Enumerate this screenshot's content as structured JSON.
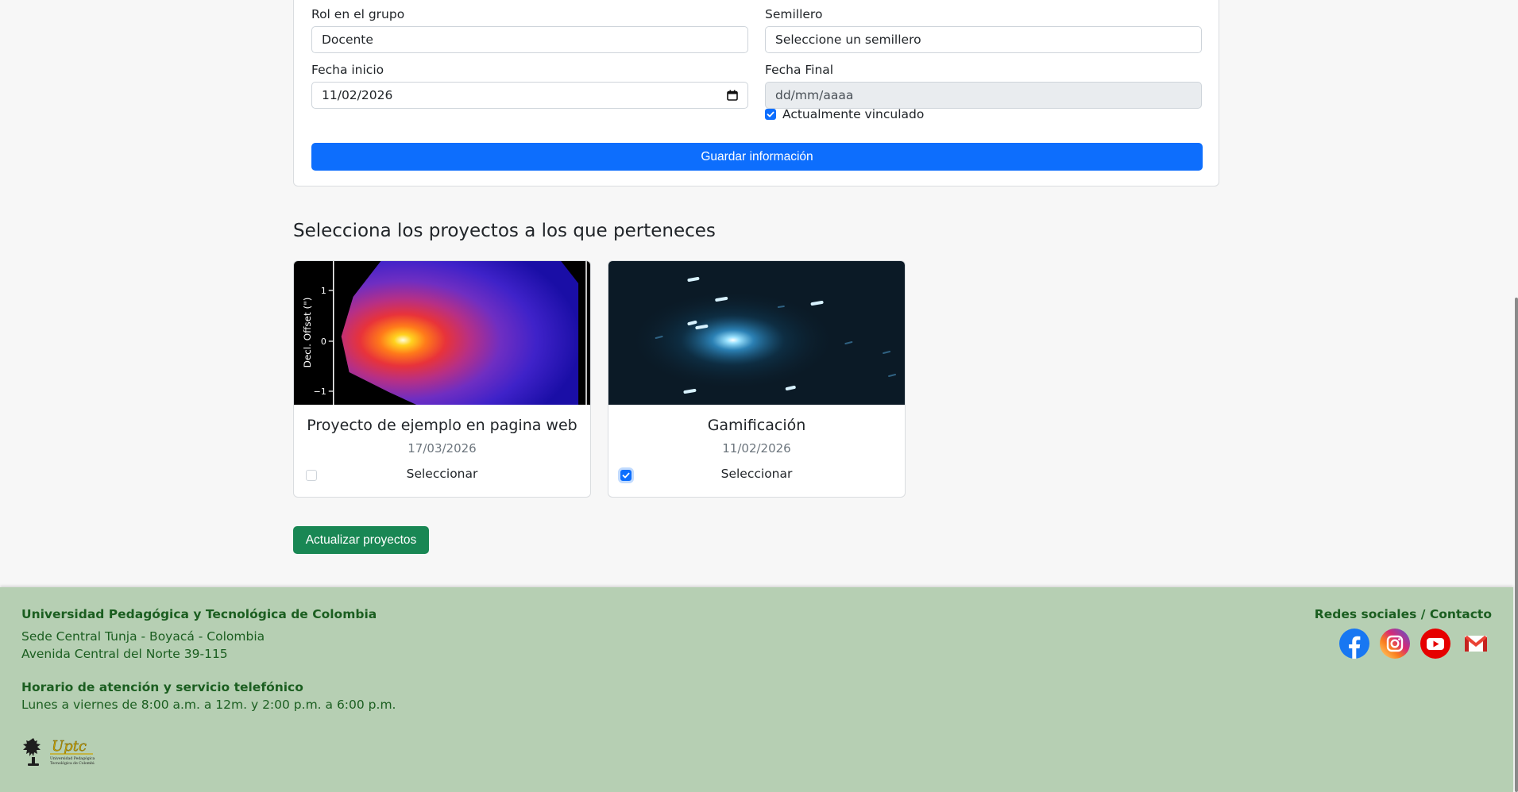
{
  "form": {
    "rol_label": "Rol en el grupo",
    "rol_value": "Docente",
    "semillero_label": "Semillero",
    "semillero_value": "Seleccione un semillero",
    "fecha_inicio_label": "Fecha inicio",
    "fecha_inicio_value": "11/02/2026",
    "fecha_final_label": "Fecha Final",
    "fecha_final_value": "dd/mm/aaaa",
    "vinculado_label": "Actualmente vinculado",
    "vinculado_checked": true,
    "save_label": "Guardar información"
  },
  "projects": {
    "title": "Selecciona los proyectos a los que perteneces",
    "items": [
      {
        "title": "Proyecto de ejemplo en pagina web",
        "date": "17/03/2026",
        "select_label": "Seleccionar",
        "selected": false,
        "image_text": {
          "axis_label": "Decl. Offset (\")",
          "ticks": [
            "1",
            "0",
            "−1"
          ]
        }
      },
      {
        "title": "Gamificación",
        "date": "11/02/2026",
        "select_label": "Seleccionar",
        "selected": true
      }
    ],
    "update_label": "Actualizar proyectos"
  },
  "footer": {
    "university": "Universidad Pedagógica y Tecnológica de Colombia",
    "address_line1": "Sede Central Tunja - Boyacá - Colombia",
    "address_line2": "Avenida Central del Norte 39-115",
    "hours_title": "Horario de atención y servicio telefónico",
    "hours_text": "Lunes a viernes de 8:00 a.m. a 12m. y 2:00 p.m. a 6:00 p.m.",
    "social_title": "Redes sociales / Contacto",
    "social_icons": [
      "facebook-icon",
      "instagram-icon",
      "youtube-icon",
      "gmail-icon"
    ],
    "logo_text": "Uptc",
    "logo_subtext": "Universidad Pedagógica y Tecnológica de Colombia"
  },
  "colors": {
    "primary": "#0d6efd",
    "success": "#198754",
    "footer_bg": "#b6cfb3",
    "footer_text": "#1b5e20"
  }
}
